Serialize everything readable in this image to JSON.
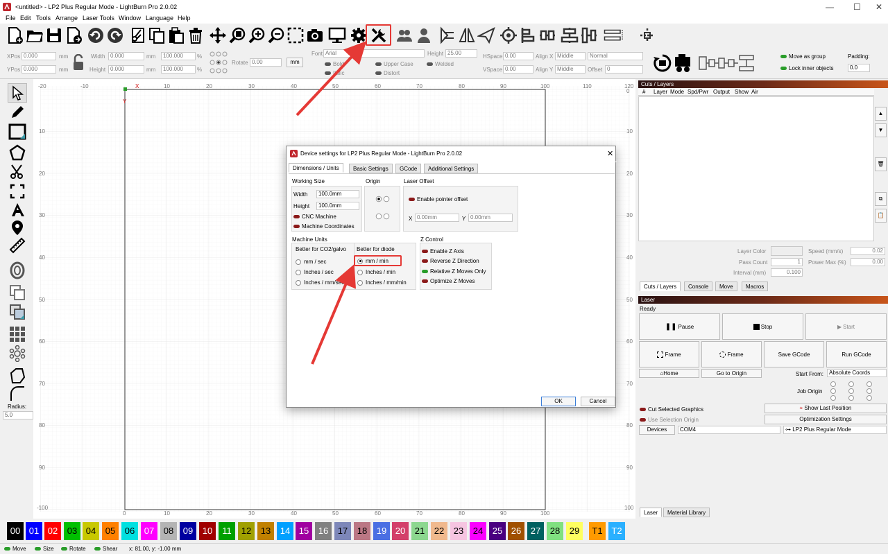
{
  "window": {
    "title": "<untitled> - LP2 Plus Regular Mode - LightBurn Pro 2.0.02",
    "minimize": "—",
    "maximize": "☐",
    "close": "✕"
  },
  "menu": [
    "File",
    "Edit",
    "Tools",
    "Arrange",
    "Laser Tools",
    "Window",
    "Language",
    "Help"
  ],
  "toolbar_icons": [
    "new-file-icon",
    "open-file-icon",
    "save-icon",
    "import-icon",
    "undo-icon",
    "redo-icon",
    "cut-icon",
    "copy-icon",
    "paste-icon",
    "delete-icon",
    "move-icon",
    "zoom-page-icon",
    "zoom-in-icon",
    "zoom-out-icon",
    "zoom-frame-icon",
    "camera-icon",
    "monitor-icon",
    "settings-gear-icon",
    "device-settings-wrench-icon",
    "users-icon",
    "user-icon",
    "mirror-icon",
    "flip-icon",
    "send-icon",
    "target-icon",
    "align-icon",
    "distribute-icon",
    "align-center-icon",
    "align-middle-icon",
    "spacing-icon",
    "dock-icon"
  ],
  "props": {
    "xpos_label": "XPos",
    "xpos_value": "0.000",
    "ypos_label": "YPos",
    "ypos_value": "0.000",
    "mm": "mm",
    "width_label": "Width",
    "width_value": "0.000",
    "height_label": "Height",
    "height_value": "0.000",
    "scale_w": "100.000",
    "scale_h": "100.000",
    "pct": "%",
    "rotate_label": "Rotate",
    "rotate_value": "0.00",
    "unit_btn": "mm",
    "font_label": "Font",
    "font_value": "Arial",
    "fheight_label": "Height",
    "fheight_value": "25.00",
    "hspace_label": "HSpace",
    "hspace_value": "0.00",
    "vspace_label": "VSpace",
    "vspace_value": "0.00",
    "alignx_label": "Align X",
    "alignx_value": "Middle",
    "aligny_label": "Align Y",
    "aligny_value": "Middle",
    "normal_value": "Normal",
    "offset_label": "Offset",
    "offset_value": "0",
    "bold": "Bold",
    "italic": "Italic",
    "upper_case": "Upper Case",
    "welded": "Welded",
    "distort": "Distort",
    "move_as_group": "Move as group",
    "lock_inner": "Lock inner objects",
    "padding_label": "Padding:",
    "padding_value": "0.0"
  },
  "left_tools": [
    "select-icon",
    "edit-nodes-icon",
    "rectangle-icon",
    "polygon-icon",
    "trim-icon",
    "position-icon",
    "text-icon",
    "place-pin-icon",
    "measure-icon",
    "offset-icon",
    "group-icon",
    "ungroup-icon",
    "grid-array-icon",
    "circular-array-icon",
    "corner-icon",
    "radius-icon"
  ],
  "radius": {
    "label": "Radius:",
    "value": "5.0"
  },
  "ruler": {
    "top": [
      "-20",
      "-10",
      "0",
      "10",
      "20",
      "30",
      "40",
      "50",
      "60",
      "70",
      "80",
      "90",
      "100",
      "110",
      "120"
    ],
    "left": [
      "10",
      "20",
      "30",
      "40",
      "50",
      "60",
      "70",
      "80",
      "90",
      "100"
    ],
    "right": [
      "0",
      "10",
      "20",
      "30",
      "40",
      "50",
      "60",
      "70",
      "80",
      "90"
    ],
    "bottom": [
      "0",
      "10",
      "20",
      "30",
      "40",
      "50",
      "60",
      "70",
      "80",
      "90",
      "100"
    ],
    "x_marker": "X",
    "y_marker": "Y",
    "corner_top": "-20",
    "corner_bottom": "-100",
    "top_right": "120",
    "bottom_right": "100"
  },
  "palette": [
    {
      "label": "00",
      "color": "#000000",
      "fg": "#ffffff"
    },
    {
      "label": "01",
      "color": "#0000ff",
      "fg": "#ffffff"
    },
    {
      "label": "02",
      "color": "#ff0000",
      "fg": "#ffffff"
    },
    {
      "label": "03",
      "color": "#00c000",
      "fg": "#000000"
    },
    {
      "label": "04",
      "color": "#c8c800",
      "fg": "#000000"
    },
    {
      "label": "05",
      "color": "#ff8000",
      "fg": "#000000"
    },
    {
      "label": "06",
      "color": "#00e0e0",
      "fg": "#000000"
    },
    {
      "label": "07",
      "color": "#ff00ff",
      "fg": "#ffffff"
    },
    {
      "label": "08",
      "color": "#b4b4b4",
      "fg": "#000000"
    },
    {
      "label": "09",
      "color": "#0000a0",
      "fg": "#ffffff"
    },
    {
      "label": "10",
      "color": "#a00000",
      "fg": "#ffffff"
    },
    {
      "label": "11",
      "color": "#00a000",
      "fg": "#ffffff"
    },
    {
      "label": "12",
      "color": "#a0a000",
      "fg": "#000000"
    },
    {
      "label": "13",
      "color": "#c08000",
      "fg": "#000000"
    },
    {
      "label": "14",
      "color": "#00a0ff",
      "fg": "#ffffff"
    },
    {
      "label": "15",
      "color": "#a000a0",
      "fg": "#ffffff"
    },
    {
      "label": "16",
      "color": "#808080",
      "fg": "#ffffff"
    },
    {
      "label": "17",
      "color": "#7d87b9",
      "fg": "#000000"
    },
    {
      "label": "18",
      "color": "#bb7784",
      "fg": "#000000"
    },
    {
      "label": "19",
      "color": "#4a6fe3",
      "fg": "#ffffff"
    },
    {
      "label": "20",
      "color": "#d33f6a",
      "fg": "#ffffff"
    },
    {
      "label": "21",
      "color": "#8cd78f",
      "fg": "#000000"
    },
    {
      "label": "22",
      "color": "#f0b98d",
      "fg": "#000000"
    },
    {
      "label": "23",
      "color": "#f6c4e1",
      "fg": "#000000"
    },
    {
      "label": "24",
      "color": "#fa00ff",
      "fg": "#000000"
    },
    {
      "label": "25",
      "color": "#4a0080",
      "fg": "#ffffff"
    },
    {
      "label": "26",
      "color": "#a05000",
      "fg": "#ffffff"
    },
    {
      "label": "27",
      "color": "#006060",
      "fg": "#ffffff"
    },
    {
      "label": "28",
      "color": "#80e080",
      "fg": "#000000"
    },
    {
      "label": "29",
      "color": "#ffff60",
      "fg": "#000000"
    },
    {
      "label": "T1",
      "color": "#ff9a00",
      "fg": "#000000"
    },
    {
      "label": "T2",
      "color": "#2ab0ff",
      "fg": "#ffffff"
    }
  ],
  "status": {
    "move": "Move",
    "size": "Size",
    "rotate": "Rotate",
    "shear": "Shear",
    "coords": "x: 81.00, y: -1.00 mm"
  },
  "cuts": {
    "title": "Cuts / Layers",
    "headers": [
      "#",
      "Layer",
      "Mode",
      "Spd/Pwr",
      "Output",
      "Show",
      "Air"
    ],
    "layer_color": "Layer Color",
    "speed_label": "Speed (mm/s)",
    "speed_value": "0.02",
    "pass_label": "Pass Count",
    "pass_value": "1",
    "power_label": "Power Max (%)",
    "power_value": "0.00",
    "interval_label": "Interval (mm)",
    "interval_value": "0.100",
    "tabs": [
      "Cuts / Layers",
      "Console",
      "Move",
      "Macros"
    ]
  },
  "laser": {
    "title": "Laser",
    "state": "Ready",
    "pause": "Pause",
    "stop": "Stop",
    "start": "Start",
    "frame1": "Frame",
    "frame2": "Frame",
    "save_gcode": "Save GCode",
    "run_gcode": "Run GCode",
    "home": "Home",
    "go_origin": "Go to Origin",
    "start_from_label": "Start From:",
    "start_from_value": "Absolute Coords",
    "job_origin": "Job Origin",
    "cut_selected": "Cut Selected Graphics",
    "use_selection_origin": "Use Selection Origin",
    "show_last": "Show Last Position",
    "opt_settings": "Optimization Settings",
    "devices": "Devices",
    "port": "COM4",
    "device": "LP2 Plus Regular Mode",
    "bottom_tabs": [
      "Laser",
      "Material Library"
    ]
  },
  "dialog": {
    "title": "Device settings for LP2 Plus Regular Mode - LightBurn Pro 2.0.02",
    "tabs": [
      "Dimensions / Units",
      "Basic Settings",
      "GCode",
      "Additional Settings"
    ],
    "working_size": "Working Size",
    "width_label": "Width",
    "width_value": "100.0mm",
    "height_label": "Height",
    "height_value": "100.0mm",
    "cnc": "CNC Machine",
    "machine_coords": "Machine Coordinates",
    "origin": "Origin",
    "laser_offset": "Laser Offset",
    "enable_pointer": "Enable pointer offset",
    "x_label": "X",
    "x_value": "0.00mm",
    "y_label": "Y",
    "y_value": "0.00mm",
    "machine_units": "Machine Units",
    "co2": "Better for CO2/galvo",
    "diode": "Better for diode",
    "mm_sec": "mm / sec",
    "in_sec": "Inches / sec",
    "in_mmsec": "Inches / mm/sec",
    "mm_min": "mm / min",
    "in_min": "Inches / min",
    "in_mmmin": "Inches / mm/min",
    "z_control": "Z Control",
    "enable_z": "Enable Z Axis",
    "reverse_z": "Reverse Z Direction",
    "relative_z": "Relative Z Moves Only",
    "optimize_z": "Optimize Z Moves",
    "ok": "OK",
    "cancel": "Cancel",
    "close": "✕"
  }
}
